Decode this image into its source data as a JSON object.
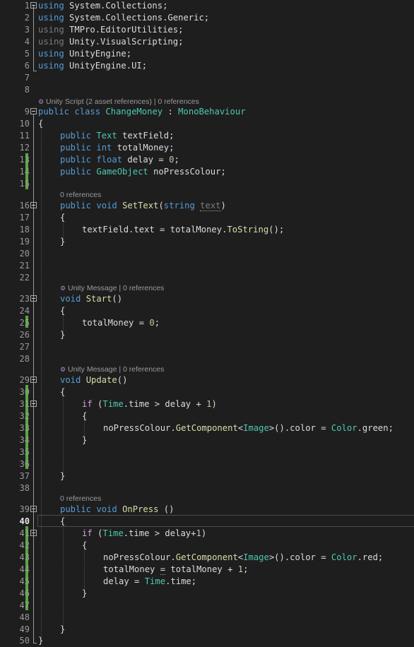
{
  "line_numbers": [
    "1",
    "2",
    "3",
    "4",
    "5",
    "6",
    "7",
    "8",
    "9",
    "10",
    "11",
    "12",
    "13",
    "14",
    "15",
    "16",
    "17",
    "18",
    "19",
    "20",
    "21",
    "22",
    "23",
    "24",
    "25",
    "26",
    "27",
    "28",
    "29",
    "30",
    "31",
    "32",
    "33",
    "34",
    "35",
    "36",
    "37",
    "38",
    "39",
    "40",
    "41",
    "42",
    "43",
    "44",
    "45",
    "46",
    "47",
    "48",
    "49",
    "50"
  ],
  "current_line": "40",
  "codelens": {
    "class": {
      "kind": "Unity Script (2 asset references)",
      "sep": " | ",
      "refs": "0 references"
    },
    "settext": {
      "refs": "0 references"
    },
    "start": {
      "kind": "Unity Message",
      "sep": " | ",
      "refs": "0 references"
    },
    "update": {
      "kind": "Unity Message",
      "sep": " | ",
      "refs": "0 references"
    },
    "onpress": {
      "refs": "0 references"
    }
  },
  "code": {
    "l1": {
      "kw": "using",
      "rest": " System.Collections;"
    },
    "l2": {
      "kw": "using",
      "rest": " System.Collections.Generic;"
    },
    "l3": {
      "kw": "using",
      "rest": " TMPro.EditorUtilities;"
    },
    "l4": {
      "kw": "using",
      "rest": " Unity.VisualScripting;"
    },
    "l5": {
      "kw": "using",
      "rest": " UnityEngine;"
    },
    "l6": {
      "kw": "using",
      "rest": " UnityEngine.UI;"
    },
    "l9": {
      "kw1": "public",
      "kw2": "class",
      "name": "ChangeMoney",
      "colon": " : ",
      "base": "MonoBehaviour"
    },
    "l10": "{",
    "l11": {
      "kw": "public",
      "type": "Text",
      "rest": " textField;"
    },
    "l12": {
      "kw": "public",
      "type": "int",
      "rest": " totalMoney;"
    },
    "l13": {
      "kw": "public",
      "type": "float",
      "rest": " delay = ",
      "num": "0",
      "end": ";"
    },
    "l14": {
      "kw": "public",
      "type": "GameObject",
      "rest": " noPressColour;"
    },
    "l16": {
      "kw": "public",
      "kw2": "void",
      "fn": "SetText",
      "open": "(",
      "ptype": "string",
      "param": "text",
      "close": ")"
    },
    "l17": "{",
    "l18": {
      "a": "textField.text = totalMoney.",
      "fn": "ToString",
      "b": "();"
    },
    "l19": "}",
    "l23": {
      "kw": "void",
      "fn": "Start",
      "rest": "()"
    },
    "l24": "{",
    "l25": {
      "a": "totalMoney = ",
      "num": "0",
      "b": ";"
    },
    "l26": "}",
    "l29": {
      "kw": "void",
      "fn": "Update",
      "rest": "()"
    },
    "l30": "{",
    "l31": {
      "kw": "if",
      "a": " (",
      "type": "Time",
      "b": ".time > delay + ",
      "num": "1",
      "c": ")"
    },
    "l32": "{",
    "l33": {
      "a": "noPressColour.",
      "fn": "GetComponent",
      "lt": "<",
      "type": "Image",
      "gt": ">().color = ",
      "type2": "Color",
      "b": ".green;"
    },
    "l34": "}",
    "l37": "}",
    "l39": {
      "kw": "public",
      "kw2": "void",
      "fn": "OnPress",
      "rest": " ()"
    },
    "l40": "{",
    "l41": {
      "kw": "if",
      "a": " (",
      "type": "Time",
      "b": ".time > delay+",
      "num": "1",
      "c": ")"
    },
    "l42": "{",
    "l43": {
      "a": "noPressColour.",
      "fn": "GetComponent",
      "lt": "<",
      "type": "Image",
      "gt": ">().color = ",
      "type2": "Color",
      "b": ".red;"
    },
    "l44": {
      "a": "totalMoney ",
      "eq": "=",
      "b": " totalMoney + ",
      "num": "1",
      "c": ";"
    },
    "l45": {
      "a": "delay = ",
      "type": "Time",
      "b": ".time;"
    },
    "l46": "}",
    "l49": "}",
    "l50": "}"
  },
  "colors": {
    "background": "#1e1e1e",
    "keyword": "#569cd6",
    "control": "#d8a0df",
    "type": "#4ec9b0",
    "method": "#dcdcaa",
    "number": "#b5cea8",
    "change_bar": "#56a83f"
  }
}
